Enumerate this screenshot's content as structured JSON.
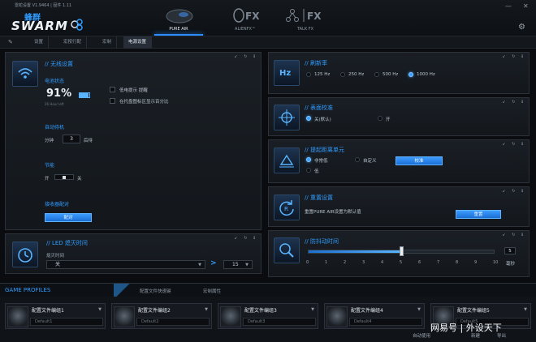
{
  "window": {
    "title": "雷蛇设置 V1.9464 | 固件 1.11",
    "minimize": "—",
    "close": "✕",
    "logo_cn": "蜂群",
    "logo_en": "SWARM",
    "modes": [
      "PURE AIR",
      "ALIENFX™",
      "TALK FX"
    ]
  },
  "tabs": [
    "设置",
    "宏按行配",
    "宏制",
    "电源设置"
  ],
  "wireless": {
    "title": "无线设置",
    "battery_label": "电池状态",
    "battery_value": "91%",
    "battery_note": "26 Hour left",
    "checkbox1": "低电提示 提醒",
    "checkbox2": "在托盘图标区显示百分比",
    "sleep_label": "自动待机",
    "sleep_prefix": "分钟",
    "sleep_value": "3",
    "sleep_suffix": "后待",
    "power_label": "节能",
    "power_on": "开",
    "power_off": "关",
    "pair_label": "接收器配对",
    "pair_button": "配对"
  },
  "led": {
    "title": "LED 熄灭时间",
    "select_label": "熄灭时间",
    "select_value": "关",
    "arrow": ">",
    "minutes_value": "15"
  },
  "polling": {
    "title": "刷新率",
    "options": [
      "125 Hz",
      "250 Hz",
      "500 Hz",
      "1000 Hz"
    ],
    "selected": 3
  },
  "surface": {
    "title": "表面校准",
    "options": [
      "关(默认)",
      "开"
    ],
    "selected": 0
  },
  "lod": {
    "title": "提起距离单元",
    "options": [
      "非常低",
      "自定义",
      "低"
    ],
    "selected": 0,
    "button": "校准"
  },
  "reset": {
    "title": "重置设置",
    "desc": "重置PURE AIR设置为默认值",
    "button": "重置"
  },
  "debounce": {
    "title": "防抖动时间",
    "value": "5",
    "level": 5,
    "ticks": [
      "0",
      "1",
      "2",
      "3",
      "4",
      "5",
      "6",
      "7",
      "8",
      "9",
      "10"
    ],
    "unit": "毫秒"
  },
  "profiles": {
    "header": "GAME PROFILES",
    "header_tabs": [
      "配置文件快速键",
      "宏制属性"
    ],
    "cards": [
      {
        "name": "配置文件编组1",
        "default": "Default1"
      },
      {
        "name": "配置文件编组2",
        "default": "Default2"
      },
      {
        "name": "配置文件编组3",
        "default": "Default3"
      },
      {
        "name": "配置文件编组4",
        "default": "Default4"
      },
      {
        "name": "配置文件编组5",
        "default": "Default5"
      }
    ],
    "footer_left": "自动使用",
    "footer_mid": "新建",
    "footer_right": "导出"
  },
  "watermark": "网易号 | 外设天下",
  "colors": {
    "accent": "#2f9cff",
    "bg": "#0a0c0f",
    "panel": "#1a1f25"
  }
}
